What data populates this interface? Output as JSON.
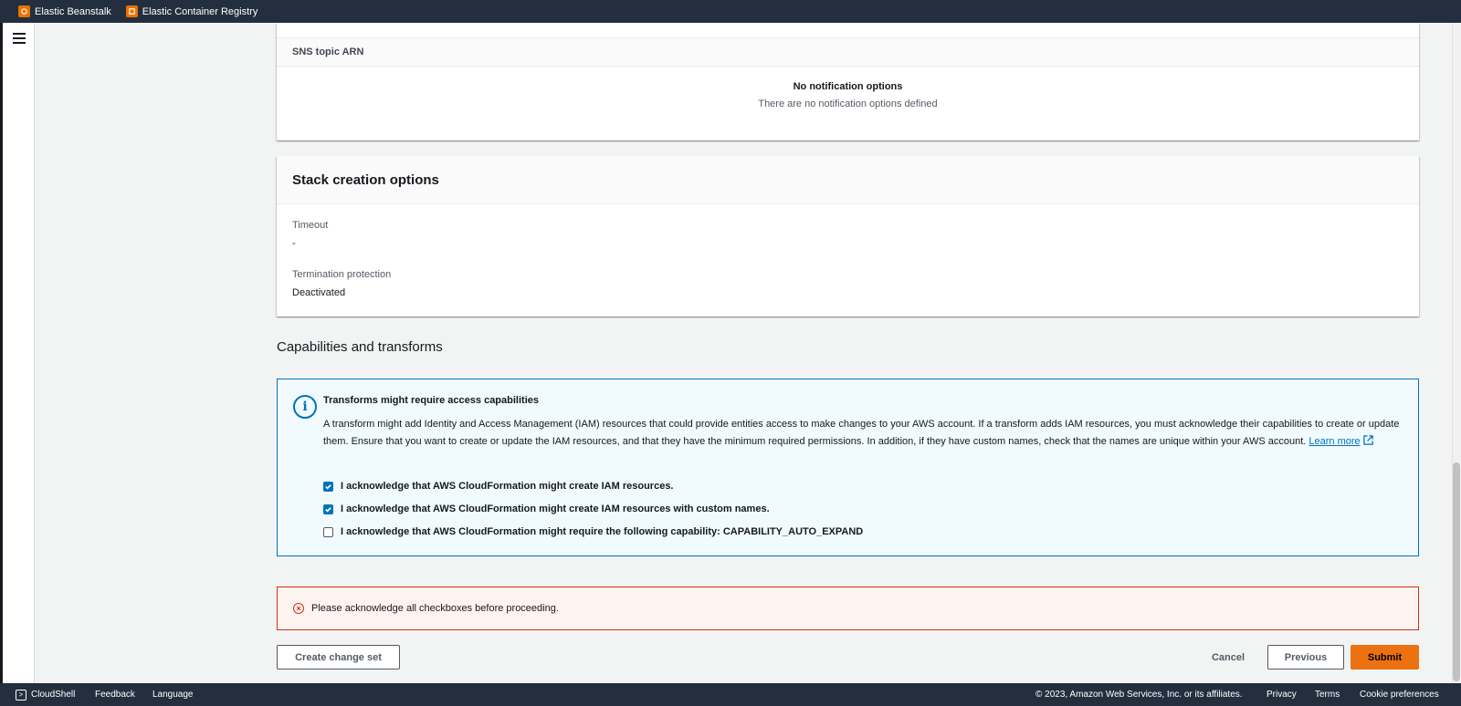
{
  "favorites": [
    {
      "label": "Elastic Beanstalk",
      "icon": "elastic-beanstalk-icon"
    },
    {
      "label": "Elastic Container Registry",
      "icon": "ecr-icon"
    }
  ],
  "sns": {
    "column_header": "SNS topic ARN",
    "empty_title": "No notification options",
    "empty_desc": "There are no notification options defined"
  },
  "stack_options": {
    "title": "Stack creation options",
    "timeout_label": "Timeout",
    "timeout_value": "-",
    "termination_label": "Termination protection",
    "termination_value": "Deactivated"
  },
  "capabilities": {
    "section_title": "Capabilities and transforms",
    "alert_title": "Transforms might require access capabilities",
    "alert_body": "A transform might add Identity and Access Management (IAM) resources that could provide entities access to make changes to your AWS account. If a transform adds IAM resources, you must acknowledge their capabilities to create or update them. Ensure that you want to create or update the IAM resources, and that they have the minimum required permissions. In addition, if they have custom names, check that the names are unique within your AWS account.",
    "learn_more": "Learn more",
    "checkboxes": [
      {
        "label": "I acknowledge that AWS CloudFormation might create IAM resources.",
        "checked": true
      },
      {
        "label": "I acknowledge that AWS CloudFormation might create IAM resources with custom names.",
        "checked": true
      },
      {
        "label": "I acknowledge that AWS CloudFormation might require the following capability: CAPABILITY_AUTO_EXPAND",
        "checked": false
      }
    ]
  },
  "error": {
    "message": "Please acknowledge all checkboxes before proceeding."
  },
  "actions": {
    "create_change_set": "Create change set",
    "cancel": "Cancel",
    "previous": "Previous",
    "submit": "Submit"
  },
  "footer": {
    "cloudshell": "CloudShell",
    "feedback": "Feedback",
    "language": "Language",
    "copyright": "© 2023, Amazon Web Services, Inc. or its affiliates.",
    "privacy": "Privacy",
    "terms": "Terms",
    "cookie": "Cookie preferences"
  },
  "colors": {
    "nav_bg": "#232f3e",
    "accent": "#0073bb",
    "primary_button": "#ec7211",
    "error": "#d13212"
  }
}
